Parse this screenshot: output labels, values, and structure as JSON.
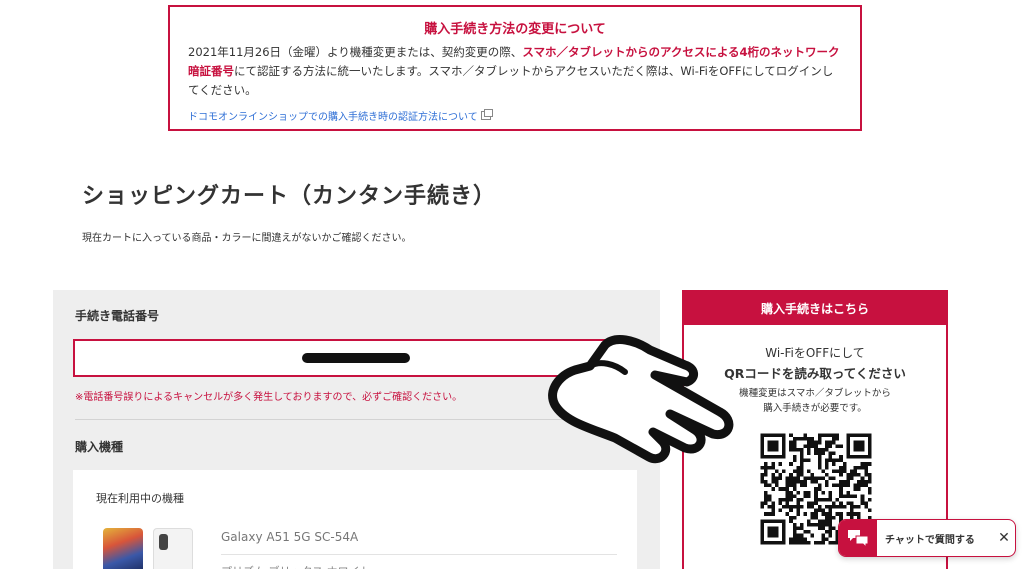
{
  "notice": {
    "title": "購入手続き方法の変更について",
    "body_1": "2021年11月26日（金曜）より機種変更または、契約変更の際、",
    "body_highlight": "スマホ／タブレットからのアクセスによる4桁のネットワーク暗証番号",
    "body_2": "にて認証する方法に統一いたします。スマホ／タブレットからアクセスいただく際は、Wi-FiをOFFにしてログインしてください。",
    "link": "ドコモオンラインショップでの購入手続き時の認証方法について",
    "link_icon": "external-window-icon"
  },
  "page": {
    "title": "ショッピングカート（カンタン手続き）",
    "subtitle": "現在カートに入っている商品・カラーに間違えがないかご確認ください。"
  },
  "form": {
    "tel_label": "手続き電話番号",
    "tel_warning": "※電話番号誤りによるキャンセルが多く発生しておりますので、必ずご確認ください。",
    "model_label": "購入機種",
    "current_device_title": "現在利用中の機種",
    "device_name": "Galaxy A51 5G SC-54A",
    "device_color": "プリズム ブリックス ホワイト"
  },
  "side": {
    "header": "購入手続きはこちら",
    "line1": "Wi-FiをOFFにして",
    "line2": "QRコードを読み取ってください",
    "line3": "機種変更はスマホ／タブレットから",
    "line4": "購入手続きが必要です。"
  },
  "chat": {
    "label": "チャットで質問する",
    "close": "✕",
    "icon": "chat-bubbles-icon"
  },
  "colors": {
    "accent": "#c7113f",
    "link": "#2f6fd6",
    "panel_bg": "#eeeeee"
  }
}
